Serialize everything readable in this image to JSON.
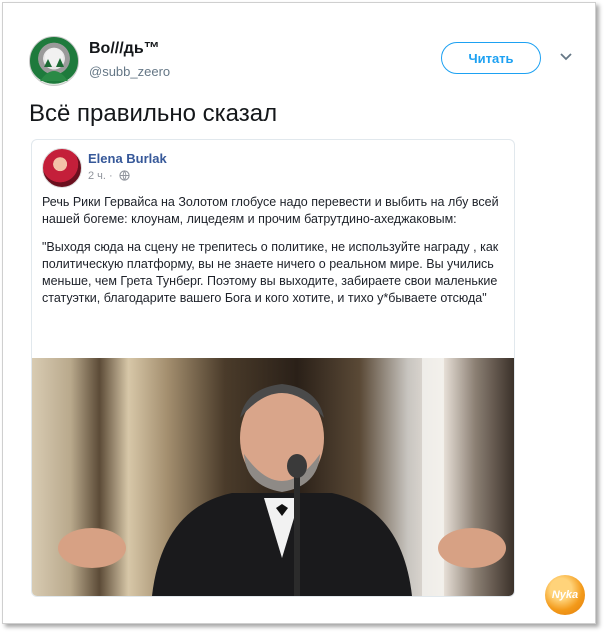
{
  "tweet": {
    "author_name": "Во///дь™",
    "author_handle": "@subb_zeero",
    "follow_label": "Читать",
    "text": "Всё правильно сказал"
  },
  "embedded_post": {
    "author_name": "Elena Burlak",
    "meta_time": "2 ч. ·",
    "paragraph_1": "Речь Рики Гервайса на Золотом глобусе надо перевести и выбить на лбу всей нашей богеме: клоунам, лицедеям и прочим батрутдино-ахеджаковым:",
    "paragraph_2": "\"Выходя сюда на сцену не трепитесь о политике, не используйте награду , как политическую платформу, вы не знаете ничего о реальном мире. Вы учились меньше, чем Грета Тунберг. Поэтому вы выходите, забираете свои маленькие статуэтки, благодарите вашего Бога и кого хотите, и тихо у*бываете отсюда\""
  },
  "watermark": {
    "text": "Nyka"
  },
  "colors": {
    "accent": "#1da1f2",
    "fb_link": "#365899",
    "text": "#14171a",
    "muted": "#657786"
  },
  "icons": [
    "chevron-down-icon",
    "globe-icon"
  ]
}
